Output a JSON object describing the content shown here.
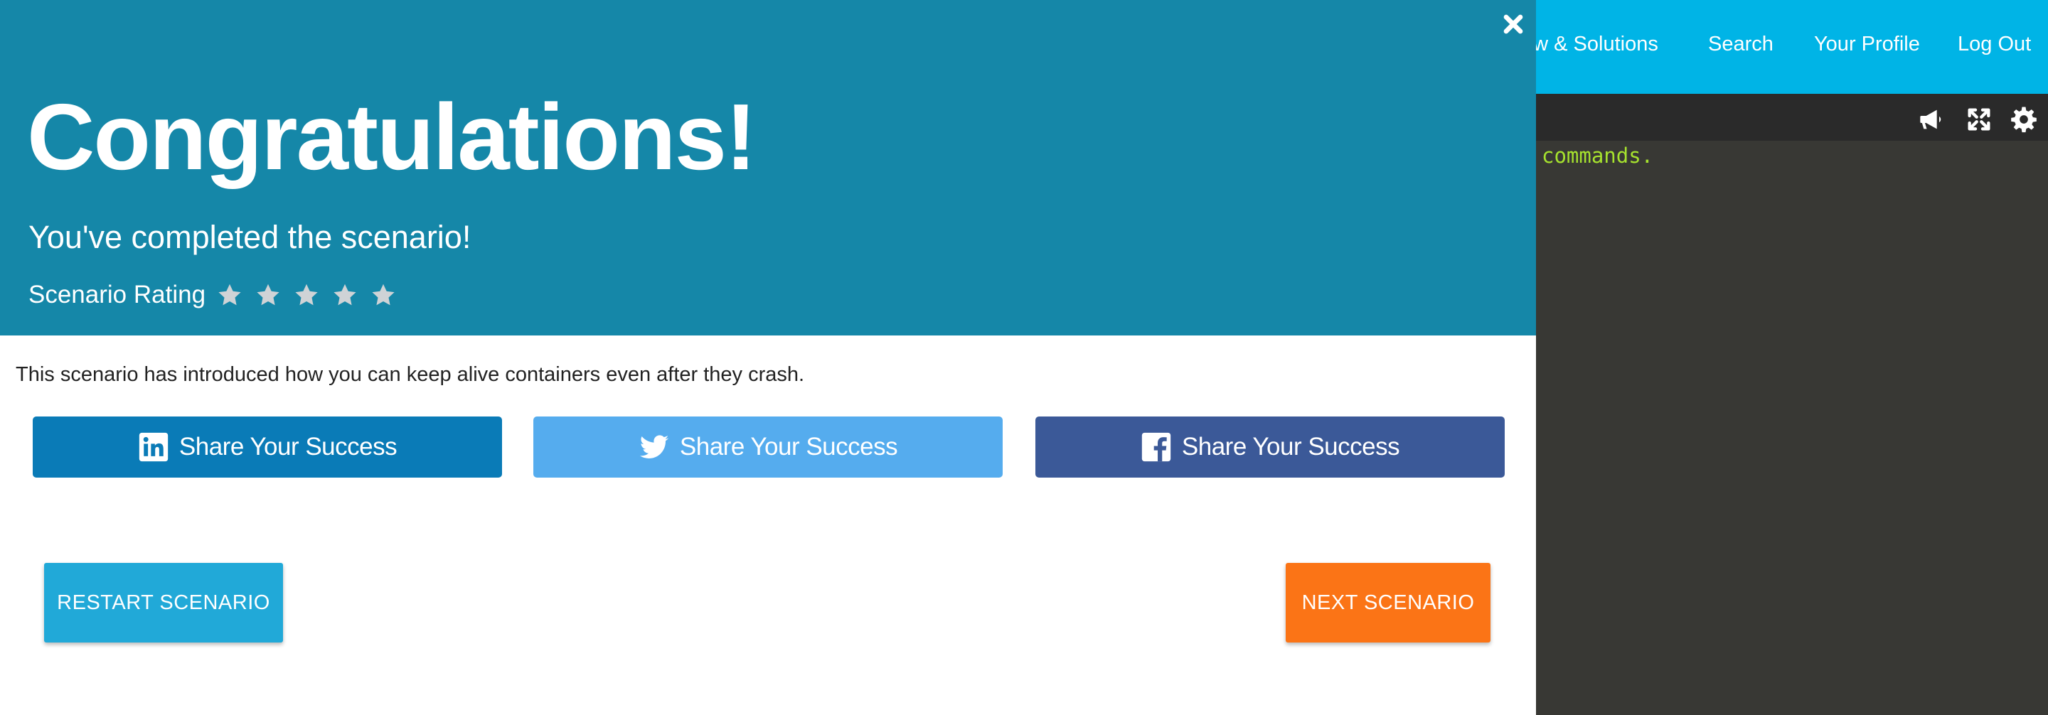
{
  "nav": {
    "items": [
      "ew & Solutions",
      "Search",
      "Your Profile",
      "Log Out"
    ]
  },
  "terminal": {
    "visible_text": "commands.",
    "toolbar_icons": [
      "megaphone-icon",
      "fullscreen-icon",
      "gear-icon"
    ]
  },
  "modal": {
    "close_icon": "close-icon",
    "title": "Congratulations!",
    "subtitle": "You've completed the scenario!",
    "rating_label": "Scenario Rating",
    "rating_stars": 5,
    "summary": "This scenario has introduced how you can keep alive containers even after they crash.",
    "share_buttons": [
      {
        "network": "linkedin",
        "label": "Share Your Success",
        "icon": "linkedin-icon",
        "color": "#0a7bb7"
      },
      {
        "network": "twitter",
        "label": "Share Your Success",
        "icon": "twitter-icon",
        "color": "#55acee"
      },
      {
        "network": "facebook",
        "label": "Share Your Success",
        "icon": "facebook-icon",
        "color": "#3b5998"
      }
    ],
    "restart_label": "RESTART SCENARIO",
    "next_label": "NEXT SCENARIO"
  },
  "colors": {
    "nav_bg": "#00b4e6",
    "modal_header_bg": "#1587a8",
    "terminal_bg": "#383834",
    "terminal_text": "#a6e22e",
    "restart_bg": "#21a9d8",
    "next_bg": "#fb7416"
  }
}
